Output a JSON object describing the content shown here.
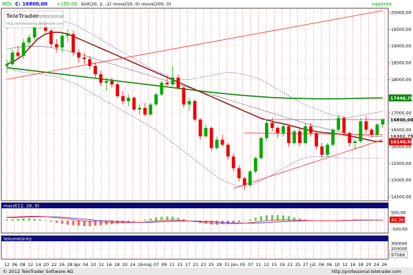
{
  "header": {
    "symbol": "MOL",
    "quote": "C: 16800,00",
    "change": "+100,00",
    "indicators": "boll(20, 2, -2)  movs(50, 0)  movs(200, 0)",
    "period": "naponta",
    "colors": {
      "symbol": "#00aa00",
      "quote": "#0000cc",
      "change": "#00aa00",
      "indicators": "#000000"
    }
  },
  "logo": {
    "line1": "TeleTrader",
    "line2": "Professional",
    "url": "http://professional.teletrader.com"
  },
  "footer": {
    "copyright": "© 2012 TeleTrader Software AG",
    "url": "http://professional.teletrader.com"
  },
  "colors": {
    "up": "#00aa00",
    "down": "#ee0000",
    "ma50": "#8b1a1a",
    "ma200": "#008800",
    "boll_mid": "#666666",
    "boll_band": "#4444aa",
    "trend": "#ff3333",
    "grid": "#ffb0b0",
    "macd": "#ff3333",
    "signal": "#3333cc"
  },
  "chart_data": [
    {
      "name": "price",
      "type": "candlestick",
      "ylim": [
        14400,
        20100
      ],
      "yticks": [
        14500,
        15000,
        15500,
        16000,
        16500,
        17000,
        17500,
        18000,
        18500,
        19000,
        19500,
        20000
      ],
      "ytick_labels": [
        "14500,00",
        "15000,00",
        "15500,00",
        "16000,00",
        "16500,00",
        "17000,00",
        "17500,00",
        "18000,00",
        "18500,00",
        "19000,00",
        "19500,00",
        "20000,00"
      ],
      "x_labels": [
        "12",
        "06",
        "08",
        "12",
        "14",
        "20",
        "22",
        "26",
        "28",
        "ápr.",
        "04",
        "10",
        "12",
        "16",
        "18",
        "20",
        "24",
        "26",
        "máj.",
        "07",
        "09",
        "11",
        "15",
        "17",
        "21",
        "23",
        "25",
        "29",
        "31",
        "jún.",
        "05",
        "07",
        "11",
        "13",
        "15",
        "19",
        "21",
        "25",
        "27",
        "júl.",
        "04",
        "06",
        "10",
        "12",
        "16",
        "18",
        "20",
        "24",
        "26"
      ],
      "ohlc": [
        [
          18400,
          18600,
          18200,
          18450
        ],
        [
          18450,
          18900,
          18400,
          18800
        ],
        [
          18800,
          19000,
          18600,
          18700
        ],
        [
          18700,
          19200,
          18600,
          19100
        ],
        [
          19100,
          19350,
          18950,
          19250
        ],
        [
          19250,
          19700,
          19150,
          19600
        ],
        [
          19600,
          19850,
          19500,
          19700
        ],
        [
          19700,
          19900,
          19400,
          19450
        ],
        [
          19450,
          19500,
          18950,
          19050
        ],
        [
          19050,
          19200,
          18800,
          18950
        ],
        [
          18950,
          19400,
          18800,
          19300
        ],
        [
          19300,
          19500,
          19100,
          19350
        ],
        [
          19350,
          19450,
          18700,
          18800
        ],
        [
          18800,
          18900,
          18500,
          18650
        ],
        [
          18650,
          18800,
          18450,
          18600
        ],
        [
          18600,
          18700,
          18300,
          18400
        ],
        [
          18400,
          18500,
          18050,
          18150
        ],
        [
          18150,
          18250,
          17800,
          17900
        ],
        [
          17900,
          18050,
          17650,
          17950
        ],
        [
          17950,
          18050,
          17750,
          17850
        ],
        [
          17850,
          17900,
          17450,
          17500
        ],
        [
          17500,
          17650,
          17250,
          17350
        ],
        [
          17350,
          17550,
          17200,
          17450
        ],
        [
          17450,
          17500,
          17050,
          17100
        ],
        [
          17100,
          17250,
          16950,
          17150
        ],
        [
          17150,
          17300,
          16900,
          16950
        ],
        [
          16950,
          17300,
          16900,
          17250
        ],
        [
          17250,
          17600,
          17200,
          17550
        ],
        [
          17550,
          17950,
          17500,
          17900
        ],
        [
          17900,
          18100,
          17800,
          17850
        ],
        [
          17850,
          18400,
          17800,
          18050
        ],
        [
          18050,
          18150,
          17700,
          17750
        ],
        [
          17750,
          17800,
          17150,
          17250
        ],
        [
          17250,
          17450,
          17050,
          17350
        ],
        [
          17350,
          17400,
          16750,
          16800
        ],
        [
          16800,
          16850,
          16200,
          16300
        ],
        [
          16300,
          16650,
          16250,
          16550
        ],
        [
          16550,
          16600,
          15850,
          15950
        ],
        [
          15950,
          16300,
          15900,
          16200
        ],
        [
          16200,
          16350,
          16000,
          16050
        ],
        [
          16050,
          16100,
          15600,
          15700
        ],
        [
          15700,
          15800,
          15250,
          15350
        ],
        [
          15350,
          15450,
          14950,
          15050
        ],
        [
          15050,
          15100,
          14700,
          14850
        ],
        [
          14850,
          15300,
          14800,
          15250
        ],
        [
          15250,
          15700,
          15200,
          15650
        ],
        [
          15650,
          16300,
          15600,
          16250
        ],
        [
          16250,
          16800,
          16150,
          16700
        ],
        [
          16700,
          16850,
          16450,
          16550
        ],
        [
          16550,
          16600,
          16250,
          16400
        ],
        [
          16400,
          16700,
          16300,
          16600
        ],
        [
          16600,
          16650,
          16000,
          16100
        ],
        [
          16100,
          16500,
          16050,
          16450
        ],
        [
          16450,
          16550,
          16000,
          16100
        ],
        [
          16100,
          16700,
          16050,
          16600
        ],
        [
          16600,
          16700,
          16300,
          16400
        ],
        [
          16400,
          16450,
          15900,
          16000
        ],
        [
          16000,
          16100,
          15650,
          15750
        ],
        [
          15750,
          16100,
          15700,
          16050
        ],
        [
          16050,
          16550,
          16000,
          16500
        ],
        [
          16500,
          16950,
          16450,
          16850
        ],
        [
          16850,
          16900,
          16300,
          16400
        ],
        [
          16400,
          16450,
          16000,
          16100
        ],
        [
          16100,
          16200,
          15900,
          16150
        ],
        [
          16150,
          16850,
          16100,
          16750
        ],
        [
          16750,
          16900,
          16400,
          16500
        ],
        [
          16500,
          16550,
          16250,
          16350
        ],
        [
          16350,
          16700,
          16300,
          16650
        ],
        [
          16650,
          16850,
          16550,
          16800
        ]
      ],
      "ma50": [
        18450,
        18550,
        18700,
        18950,
        19200,
        19350,
        19400,
        19400,
        19350,
        19250,
        19150,
        19050,
        18950,
        18850,
        18750,
        18650,
        18550,
        18450,
        18350,
        18250,
        18150,
        18050,
        17950,
        17850,
        17750,
        17650,
        17550,
        17450,
        17350,
        17250,
        17150,
        17050,
        16950,
        16850,
        16780,
        16720,
        16680,
        16620,
        16560,
        16500,
        16460,
        16420,
        16400,
        16380,
        16350,
        16300,
        16250,
        16200,
        16150,
        16140
      ],
      "ma200": [
        18350,
        18300,
        18250,
        18200,
        18150,
        18100,
        18050,
        18000,
        17950,
        17900,
        17850,
        17800,
        17750,
        17700,
        17650,
        17600,
        17560,
        17520,
        17490,
        17460,
        17440,
        17430,
        17420,
        17420,
        17420,
        17430,
        17440,
        17446
      ],
      "boll_mid": [
        18900,
        18950,
        18980,
        18990,
        18980,
        18950,
        18900,
        18850,
        18780,
        18700,
        18620,
        18540,
        18460,
        18380,
        18300,
        18220,
        18140,
        18060,
        17980,
        17900,
        17820,
        17740,
        17660,
        17580,
        17500,
        17420,
        17340,
        17260,
        17180,
        17100,
        17020,
        16940,
        16860,
        16780,
        16700,
        16620,
        16560,
        16500,
        16450,
        16400,
        16350,
        16320,
        16300,
        16302
      ],
      "boll_upper": [
        19500,
        19650,
        19750,
        19800,
        19820,
        19800,
        19750,
        19700,
        19600,
        19450,
        19300,
        19150,
        19000,
        18850,
        18700,
        18550,
        18400,
        18250,
        18150,
        18050,
        18000,
        18000,
        18050,
        18100,
        18150,
        18200,
        18200,
        18150,
        18100,
        18000,
        17850,
        17700,
        17550,
        17400,
        17250,
        17150,
        17050,
        16950,
        16900,
        16850,
        16900,
        16950,
        17000,
        17050
      ],
      "boll_lower": [
        18400,
        18250,
        18200,
        18180,
        18150,
        18100,
        18050,
        17950,
        17850,
        17700,
        17550,
        17400,
        17250,
        17100,
        16950,
        16800,
        16650,
        16500,
        16300,
        16100,
        15900,
        15700,
        15500,
        15300,
        15100,
        14950,
        14850,
        14800,
        14850,
        14950,
        15100,
        15250,
        15400,
        15550,
        15650,
        15700,
        15700,
        15700,
        15650,
        15650,
        15650,
        15650,
        15650,
        15650
      ],
      "trend_lines": [
        {
          "from": [
            0,
            18000
          ],
          "to": [
            68,
            20050
          ]
        },
        {
          "from": [
            41,
            14750
          ],
          "to": [
            68,
            16200
          ]
        },
        {
          "from": [
            43,
            16400
          ],
          "to": [
            68,
            16350
          ]
        }
      ],
      "hline": 16800,
      "price_labels": [
        {
          "text": "17446,70",
          "value": 17446,
          "bg": "#008800",
          "fg": "#ffffff"
        },
        {
          "text": "16800,00",
          "value": 16800,
          "bg": "#ffffff",
          "fg": "#000000"
        },
        {
          "text": "16302,75",
          "value": 16302,
          "bg": "#ffffff",
          "fg": "#333333"
        },
        {
          "text": "16140,50",
          "value": 16140,
          "bg": "#ee0000",
          "fg": "#ffffff"
        }
      ]
    },
    {
      "name": "macd",
      "type": "line",
      "title": "macd(12, 26, 9)",
      "ylim": [
        -700,
        700
      ],
      "yticks": [
        500,
        0,
        -500
      ],
      "ytick_labels": [
        "500,00",
        "0,00",
        "-500,00"
      ],
      "macd": [
        200,
        220,
        240,
        260,
        270,
        270,
        260,
        240,
        210,
        180,
        140,
        100,
        60,
        20,
        -20,
        -50,
        -70,
        -80,
        -90,
        -100,
        -110,
        -120,
        -120,
        -110,
        -100,
        -80,
        -50,
        -20,
        10,
        30,
        40,
        30,
        10,
        -20,
        -50,
        -80,
        -110,
        -140,
        -160,
        -170,
        -180,
        -180,
        -170,
        -150,
        -120,
        -80,
        -40,
        -10,
        20,
        40,
        50,
        50,
        40,
        30,
        20,
        10,
        0,
        -10,
        -10,
        0,
        10,
        20,
        30,
        40,
        40,
        40,
        40,
        42,
        44
      ],
      "signal": [
        180,
        190,
        200,
        210,
        220,
        230,
        235,
        235,
        230,
        220,
        200,
        180,
        150,
        120,
        90,
        60,
        30,
        10,
        -10,
        -30,
        -50,
        -70,
        -85,
        -95,
        -100,
        -100,
        -95,
        -85,
        -70,
        -55,
        -40,
        -30,
        -20,
        -20,
        -25,
        -35,
        -50,
        -65,
        -80,
        -100,
        -115,
        -130,
        -140,
        -145,
        -145,
        -140,
        -130,
        -115,
        -95,
        -75,
        -55,
        -40,
        -25,
        -15,
        -5,
        0,
        0,
        0,
        0,
        0,
        5,
        10,
        15,
        20,
        25,
        30,
        33,
        35,
        38
      ],
      "value_label": "44,36"
    },
    {
      "name": "volume",
      "type": "bar",
      "title": "VolumeUnits",
      "ylim": [
        0,
        330000
      ],
      "yticks": [
        300000,
        200000
      ],
      "ytick_labels": [
        "300000",
        "200000"
      ],
      "value_label": "97066"
    }
  ]
}
